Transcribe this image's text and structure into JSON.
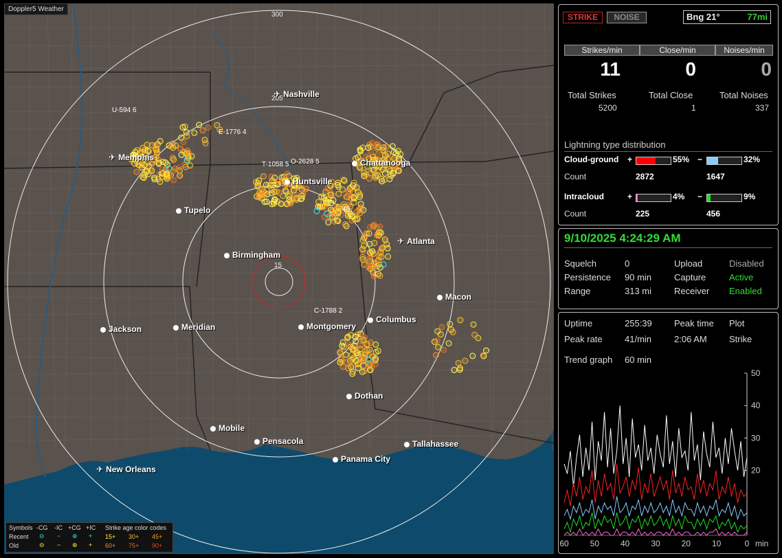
{
  "app": {
    "title": "Doppler5 Weather"
  },
  "map": {
    "ring_labels": [
      "300",
      "205",
      "15"
    ],
    "cities": [
      {
        "name": "Nashville",
        "type": "airport"
      },
      {
        "name": "Memphis",
        "type": "airport"
      },
      {
        "name": "Chattanooga",
        "type": "city"
      },
      {
        "name": "Huntsville",
        "type": "city"
      },
      {
        "name": "Tupelo",
        "type": "city"
      },
      {
        "name": "Atlanta",
        "type": "airport"
      },
      {
        "name": "Birmingham",
        "type": "city"
      },
      {
        "name": "Macon",
        "type": "city"
      },
      {
        "name": "Jackson",
        "type": "city"
      },
      {
        "name": "Meridian",
        "type": "city"
      },
      {
        "name": "Montgomery",
        "type": "city"
      },
      {
        "name": "Columbus",
        "type": "city"
      },
      {
        "name": "Dothan",
        "type": "city"
      },
      {
        "name": "Mobile",
        "type": "city"
      },
      {
        "name": "Pensacola",
        "type": "city"
      },
      {
        "name": "Tallahassee",
        "type": "city"
      },
      {
        "name": "Panama City",
        "type": "city"
      },
      {
        "name": "New Orleans",
        "type": "airport"
      }
    ],
    "storms": [
      "U-594 6",
      "E-1776 4",
      "T-1058 5",
      "O-2628 5",
      "C-1788 2",
      "45"
    ],
    "legend": {
      "title_symbols": "Symbols",
      "cols": [
        "-CG",
        "-IC",
        "+CG",
        "+IC"
      ],
      "title_age": "Strike age color codes",
      "recent_label": "Recent",
      "old_label": "Old",
      "recent_ages": [
        "15+",
        "30+",
        "45+"
      ],
      "old_ages": [
        "60+",
        "75+",
        "90+"
      ]
    }
  },
  "status": {
    "strike_btn": "STRIKE",
    "noise_btn": "NOISE",
    "bearing": "Bng 21°",
    "distance": "77mi",
    "rates": [
      {
        "label": "Strikes/min",
        "value": "11",
        "color": "#ffffff"
      },
      {
        "label": "Close/min",
        "value": "0",
        "color": "#ffffff"
      },
      {
        "label": "Noises/min",
        "value": "0",
        "color": "#aaaaaa"
      }
    ],
    "totals": [
      {
        "label": "Total Strikes",
        "value": "5200"
      },
      {
        "label": "Total Close",
        "value": "1"
      },
      {
        "label": "Total Noises",
        "value": "337"
      }
    ],
    "dist_title": "Lightning type distribution",
    "cg_label": "Cloud-ground",
    "ic_label": "Intracloud",
    "count_label": "Count",
    "cg_pos": {
      "sign": "+",
      "pct": "55%",
      "fraction": 0.55,
      "color": "#ff0000",
      "count": "2872"
    },
    "cg_neg": {
      "sign": "−",
      "pct": "32%",
      "fraction": 0.32,
      "color": "#88ccff",
      "count": "1647"
    },
    "ic_pos": {
      "sign": "+",
      "pct": "4%",
      "fraction": 0.04,
      "color": "#ff66cc",
      "count": "225"
    },
    "ic_neg": {
      "sign": "−",
      "pct": "9%",
      "fraction": 0.09,
      "color": "#22dd22",
      "count": "456"
    }
  },
  "settings": {
    "datetime": "9/10/2025 4:24:29 AM",
    "squelch_label": "Squelch",
    "squelch": "0",
    "persistence_label": "Persistence",
    "persistence": "90 min",
    "range_label": "Range",
    "range": "313 mi",
    "upload_label": "Upload",
    "upload": "Disabled",
    "capture_label": "Capture",
    "capture": "Active",
    "receiver_label": "Receiver",
    "receiver": "Enabled"
  },
  "trend": {
    "uptime_label": "Uptime",
    "uptime": "255:39",
    "peak_time_label": "Peak time",
    "peak_time": "2:06 AM",
    "plot_label": "Plot",
    "plot": "Strike",
    "peak_rate_label": "Peak rate",
    "peak_rate": "41/min",
    "trend_label": "Trend graph",
    "trend_window": "60 min",
    "y_ticks": [
      "50",
      "40",
      "30",
      "20"
    ],
    "x_ticks": [
      "60",
      "50",
      "40",
      "30",
      "20",
      "10",
      "0"
    ],
    "x_unit": "min"
  },
  "chart_data": {
    "type": "line",
    "xlabel": "min",
    "ylim": [
      0,
      50
    ],
    "xlim": [
      60,
      0
    ],
    "series": [
      {
        "name": "",
        "color": "#ffffff",
        "values": [
          22,
          19,
          26,
          15,
          24,
          31,
          18,
          27,
          20,
          35,
          17,
          29,
          23,
          38,
          21,
          33,
          19,
          26,
          40,
          22,
          30,
          18,
          36,
          24,
          28,
          20,
          34,
          23,
          27,
          19,
          31,
          25,
          21,
          37,
          22,
          29,
          18,
          33,
          24,
          26,
          20,
          38,
          23,
          28,
          17,
          32,
          25,
          21,
          35,
          24,
          27,
          19,
          30,
          22,
          33,
          26,
          20,
          29,
          18,
          24
        ]
      },
      {
        "name": "",
        "color": "#ff2222",
        "values": [
          10,
          14,
          9,
          16,
          12,
          18,
          11,
          15,
          13,
          20,
          10,
          17,
          12,
          19,
          14,
          16,
          11,
          22,
          13,
          15,
          18,
          12,
          17,
          14,
          21,
          11,
          16,
          13,
          19,
          12,
          15,
          18,
          14,
          17,
          11,
          20,
          13,
          16,
          12,
          18,
          14,
          15,
          11,
          19,
          13,
          17,
          12,
          16,
          14,
          20,
          11,
          15,
          13,
          18,
          12,
          16,
          10,
          14,
          12,
          13
        ]
      },
      {
        "name": "",
        "color": "#88ccff",
        "values": [
          6,
          8,
          5,
          9,
          7,
          10,
          6,
          8,
          7,
          11,
          5,
          9,
          7,
          10,
          8,
          9,
          6,
          12,
          7,
          8,
          10,
          6,
          9,
          8,
          11,
          6,
          9,
          7,
          10,
          7,
          8,
          10,
          7,
          9,
          6,
          11,
          7,
          9,
          6,
          10,
          8,
          8,
          6,
          10,
          7,
          9,
          6,
          9,
          8,
          11,
          6,
          8,
          7,
          10,
          6,
          9,
          5,
          8,
          6,
          7
        ]
      },
      {
        "name": "",
        "color": "#22dd22",
        "values": [
          2,
          4,
          1,
          5,
          3,
          6,
          2,
          4,
          3,
          7,
          2,
          5,
          3,
          6,
          4,
          5,
          2,
          7,
          3,
          4,
          6,
          2,
          5,
          4,
          6,
          2,
          5,
          3,
          6,
          3,
          4,
          6,
          3,
          5,
          2,
          6,
          3,
          5,
          2,
          6,
          4,
          4,
          2,
          5,
          3,
          5,
          2,
          5,
          4,
          6,
          2,
          4,
          3,
          5,
          2,
          4,
          1,
          3,
          2,
          3
        ]
      },
      {
        "name": "",
        "color": "#ff66cc",
        "values": [
          0,
          1,
          0,
          1,
          0,
          2,
          0,
          1,
          0,
          1,
          0,
          2,
          0,
          1,
          1,
          0,
          0,
          2,
          0,
          1,
          1,
          0,
          1,
          0,
          2,
          0,
          1,
          0,
          1,
          0,
          1,
          1,
          0,
          1,
          0,
          2,
          0,
          1,
          0,
          1,
          1,
          0,
          0,
          1,
          0,
          1,
          0,
          1,
          1,
          2,
          0,
          1,
          0,
          1,
          0,
          1,
          0,
          0,
          0,
          1
        ]
      }
    ]
  }
}
